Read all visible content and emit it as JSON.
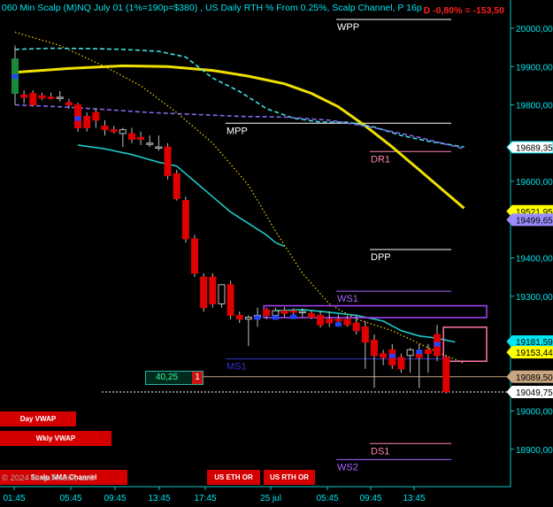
{
  "header": {
    "title": "060 Min Scalp (M)NQ July 01 (1%=190p=$380) , US Daily RTH % From 0.25%, Scalp Channel, P 16p",
    "pnl": "D -0,80% = -153,50"
  },
  "copyright": "© 2024 NinjaTrader, LLC",
  "chart_data": {
    "type": "candlestick",
    "instrument": "(M)NQ July 01",
    "y_ticks": [
      {
        "value": 20000,
        "label": "20000,00"
      },
      {
        "value": 19900,
        "label": "19900,00"
      },
      {
        "value": 19800,
        "label": "19800,00"
      },
      {
        "value": 19600,
        "label": "19600,00"
      },
      {
        "value": 19400,
        "label": "19400,00"
      },
      {
        "value": 19300,
        "label": "19300,00"
      },
      {
        "value": 19000,
        "label": "19000,00"
      },
      {
        "value": 18900,
        "label": "18900,00"
      }
    ],
    "x_ticks": [
      "01:45",
      "05:45",
      "09:45",
      "13:45",
      "17:45",
      "25 jul",
      "05:45",
      "09:45",
      "13:45"
    ],
    "price_tags": [
      {
        "value": 19689.35,
        "label": "19689,35",
        "bg": "#ffffff",
        "fg": "#000000",
        "border": "#00e5ee"
      },
      {
        "value": 19521.95,
        "label": "19521,95",
        "bg": "#ffff00",
        "fg": "#000000",
        "border": "#ffff00"
      },
      {
        "value": 19499.65,
        "label": "19499,65",
        "bg": "#9b8cff",
        "fg": "#000000",
        "border": "#9b8cff"
      },
      {
        "value": 19181.59,
        "label": "19181,59",
        "bg": "#00e5ee",
        "fg": "#000000",
        "border": "#00e5ee"
      },
      {
        "value": 19153.44,
        "label": "19153,44",
        "bg": "#ffff00",
        "fg": "#000000",
        "border": "#ffff00"
      },
      {
        "value": 19089.5,
        "label": "19089,50",
        "bg": "#c8a682",
        "fg": "#000000",
        "border": "#c8a682"
      },
      {
        "value": 19049.75,
        "label": "19049,75",
        "bg": "#ffffff",
        "fg": "#000000",
        "border": "#ffffff"
      }
    ],
    "levels": [
      {
        "name": "WPP",
        "value": 20023,
        "color": "#ffffff",
        "from": 380,
        "to": 510
      },
      {
        "name": "MPP",
        "value": 19752,
        "color": "#ffffff",
        "from": 255,
        "to": 510
      },
      {
        "name": "DR1",
        "value": 19678,
        "color": "#ff88aa",
        "from": 418,
        "to": 510
      },
      {
        "name": "DPP",
        "value": 19422,
        "color": "#ffffff",
        "from": 418,
        "to": 510
      },
      {
        "name": "WS1",
        "value": 19313,
        "color": "#aa66ff",
        "from": 380,
        "to": 510
      },
      {
        "name": "MS1",
        "value": 19136,
        "color": "#3333cc",
        "from": 255,
        "to": 510
      },
      {
        "name": "DS1",
        "value": 18915,
        "color": "#ff88aa",
        "from": 418,
        "to": 510
      },
      {
        "name": "WS2",
        "value": 18873,
        "color": "#aa66ff",
        "from": 380,
        "to": 510
      }
    ],
    "candles": [
      {
        "o": 19920,
        "h": 19955,
        "l": 19800,
        "c": 19830
      },
      {
        "o": 19826,
        "h": 19838,
        "l": 19804,
        "c": 19820
      },
      {
        "o": 19830,
        "h": 19838,
        "l": 19796,
        "c": 19800
      },
      {
        "o": 19824,
        "h": 19832,
        "l": 19812,
        "c": 19818
      },
      {
        "o": 19820,
        "h": 19832,
        "l": 19814,
        "c": 19818
      },
      {
        "o": 19818,
        "h": 19836,
        "l": 19808,
        "c": 19820
      },
      {
        "o": 19806,
        "h": 19816,
        "l": 19790,
        "c": 19800
      },
      {
        "o": 19800,
        "h": 19806,
        "l": 19730,
        "c": 19740
      },
      {
        "o": 19770,
        "h": 19780,
        "l": 19730,
        "c": 19740
      },
      {
        "o": 19780,
        "h": 19790,
        "l": 19740,
        "c": 19760
      },
      {
        "o": 19745,
        "h": 19760,
        "l": 19720,
        "c": 19735
      },
      {
        "o": 19735,
        "h": 19745,
        "l": 19725,
        "c": 19730
      },
      {
        "o": 19725,
        "h": 19740,
        "l": 19690,
        "c": 19735
      },
      {
        "o": 19725,
        "h": 19740,
        "l": 19700,
        "c": 19710
      },
      {
        "o": 19715,
        "h": 19730,
        "l": 19695,
        "c": 19710
      },
      {
        "o": 19700,
        "h": 19720,
        "l": 19690,
        "c": 19700
      },
      {
        "o": 19690,
        "h": 19720,
        "l": 19680,
        "c": 19690
      },
      {
        "o": 19690,
        "h": 19700,
        "l": 19605,
        "c": 19615
      },
      {
        "o": 19620,
        "h": 19630,
        "l": 19550,
        "c": 19555
      },
      {
        "o": 19550,
        "h": 19560,
        "l": 19440,
        "c": 19450
      },
      {
        "o": 19450,
        "h": 19460,
        "l": 19350,
        "c": 19360
      },
      {
        "o": 19350,
        "h": 19360,
        "l": 19260,
        "c": 19270
      },
      {
        "o": 19350,
        "h": 19360,
        "l": 19270,
        "c": 19280
      },
      {
        "o": 19280,
        "h": 19330,
        "l": 19270,
        "c": 19330
      },
      {
        "o": 19330,
        "h": 19340,
        "l": 19240,
        "c": 19250
      },
      {
        "o": 19250,
        "h": 19260,
        "l": 19230,
        "c": 19240
      },
      {
        "o": 19240,
        "h": 19250,
        "l": 19170,
        "c": 19245
      },
      {
        "o": 19245,
        "h": 19270,
        "l": 19220,
        "c": 19250
      },
      {
        "o": 19265,
        "h": 19270,
        "l": 19240,
        "c": 19250
      },
      {
        "o": 19250,
        "h": 19270,
        "l": 19240,
        "c": 19262
      },
      {
        "o": 19262,
        "h": 19272,
        "l": 19245,
        "c": 19255
      },
      {
        "o": 19262,
        "h": 19268,
        "l": 19248,
        "c": 19258
      },
      {
        "o": 19258,
        "h": 19268,
        "l": 19245,
        "c": 19260
      },
      {
        "o": 19255,
        "h": 19262,
        "l": 19240,
        "c": 19245
      },
      {
        "o": 19250,
        "h": 19262,
        "l": 19218,
        "c": 19225
      },
      {
        "o": 19240,
        "h": 19260,
        "l": 19220,
        "c": 19230
      },
      {
        "o": 19240,
        "h": 19252,
        "l": 19225,
        "c": 19235
      },
      {
        "o": 19240,
        "h": 19250,
        "l": 19220,
        "c": 19225
      },
      {
        "o": 19230,
        "h": 19250,
        "l": 19200,
        "c": 19210
      },
      {
        "o": 19220,
        "h": 19235,
        "l": 19110,
        "c": 19180
      },
      {
        "o": 19185,
        "h": 19200,
        "l": 19060,
        "c": 19145
      },
      {
        "o": 19150,
        "h": 19160,
        "l": 19120,
        "c": 19140
      },
      {
        "o": 19160,
        "h": 19175,
        "l": 19110,
        "c": 19120
      },
      {
        "o": 19140,
        "h": 19150,
        "l": 19100,
        "c": 19110
      },
      {
        "o": 19145,
        "h": 19165,
        "l": 19100,
        "c": 19160
      },
      {
        "o": 19150,
        "h": 19175,
        "l": 19060,
        "c": 19140
      },
      {
        "o": 19160,
        "h": 19175,
        "l": 19100,
        "c": 19150
      },
      {
        "o": 19200,
        "h": 19225,
        "l": 19130,
        "c": 19145
      },
      {
        "o": 19140,
        "h": 19145,
        "l": 19045,
        "c": 19050
      }
    ],
    "blue_marks": [
      {
        "i": 0,
        "y": 19880
      },
      {
        "i": 7,
        "y": 19770
      },
      {
        "i": 27,
        "y": 19250
      },
      {
        "i": 29,
        "y": 19250
      },
      {
        "i": 31,
        "y": 19252
      },
      {
        "i": 36,
        "y": 19232
      },
      {
        "i": 42,
        "y": 19150
      },
      {
        "i": 45,
        "y": 19160
      },
      {
        "i": 47,
        "y": 19180
      }
    ],
    "series": [
      {
        "style": "solid-cyan",
        "color": "#1ec8c8",
        "points": [
          [
            7,
            19695
          ],
          [
            10,
            19685
          ],
          [
            13,
            19670
          ],
          [
            16,
            19650
          ],
          [
            18,
            19640
          ],
          [
            20,
            19600
          ],
          [
            22,
            19560
          ],
          [
            24,
            19520
          ],
          [
            26,
            19490
          ],
          [
            28,
            19460
          ],
          [
            29,
            19440
          ],
          [
            30,
            19430
          ]
        ]
      },
      {
        "style": "solid-yellow",
        "color": "#f0e000",
        "points": [
          [
            0,
            19885
          ],
          [
            6,
            19895
          ],
          [
            12,
            19902
          ],
          [
            17,
            19900
          ],
          [
            22,
            19890
          ],
          [
            26,
            19875
          ],
          [
            30,
            19855
          ],
          [
            33,
            19830
          ],
          [
            36,
            19795
          ],
          [
            39,
            19745
          ],
          [
            42,
            19690
          ],
          [
            45,
            19630
          ],
          [
            48,
            19570
          ],
          [
            50,
            19530
          ]
        ]
      },
      {
        "style": "dotted-yellow",
        "color": "#e8c800",
        "points": [
          [
            0,
            19990
          ],
          [
            5,
            19955
          ],
          [
            10,
            19900
          ],
          [
            14,
            19850
          ],
          [
            18,
            19780
          ],
          [
            22,
            19700
          ],
          [
            26,
            19590
          ],
          [
            29,
            19470
          ],
          [
            32,
            19360
          ],
          [
            35,
            19280
          ],
          [
            38,
            19240
          ],
          [
            42,
            19210
          ],
          [
            46,
            19165
          ],
          [
            50,
            19125
          ]
        ]
      },
      {
        "style": "dashed-cyan",
        "color": "#40e0e0",
        "points": [
          [
            0,
            19945
          ],
          [
            4,
            19948
          ],
          [
            8,
            19947
          ],
          [
            12,
            19945
          ],
          [
            16,
            19940
          ],
          [
            19,
            19925
          ],
          [
            22,
            19870
          ],
          [
            25,
            19835
          ],
          [
            28,
            19790
          ],
          [
            31,
            19765
          ],
          [
            34,
            19755
          ],
          [
            37,
            19755
          ],
          [
            40,
            19742
          ],
          [
            43,
            19720
          ],
          [
            46,
            19705
          ],
          [
            50,
            19690
          ]
        ]
      },
      {
        "style": "dashed-purple",
        "color": "#8866ee",
        "points": [
          [
            0,
            19800
          ],
          [
            5,
            19795
          ],
          [
            10,
            19788
          ],
          [
            15,
            19780
          ],
          [
            20,
            19775
          ],
          [
            25,
            19770
          ],
          [
            30,
            19768
          ],
          [
            35,
            19760
          ],
          [
            40,
            19740
          ],
          [
            45,
            19715
          ],
          [
            50,
            19685
          ]
        ]
      },
      {
        "style": "channel-cyan",
        "color": "#1ec8c8",
        "points": [
          [
            29,
            19262
          ],
          [
            32,
            19265
          ],
          [
            35,
            19258
          ],
          [
            38,
            19250
          ],
          [
            41,
            19235
          ],
          [
            43,
            19210
          ],
          [
            45,
            19196
          ],
          [
            47,
            19190
          ],
          [
            49,
            19180
          ]
        ]
      }
    ],
    "boxes": [
      {
        "name": "purple-box",
        "color": "#aa44ff",
        "y1": 19275,
        "y2": 19244,
        "i1": 28,
        "i2": 53
      },
      {
        "name": "pink-box",
        "color": "#ff77aa",
        "y1": 19219,
        "y2": 19130,
        "i1": 48,
        "i2": 53
      }
    ],
    "brown_line": 19089.5,
    "dashed_white_line": 19049.75
  },
  "position": {
    "qty": "40,25",
    "count": "1"
  },
  "bottom_tags": [
    "Day VWAP",
    "Wkly VWAP",
    "Scalp SMA Channel",
    "US ETH OR",
    "US RTH OR"
  ]
}
